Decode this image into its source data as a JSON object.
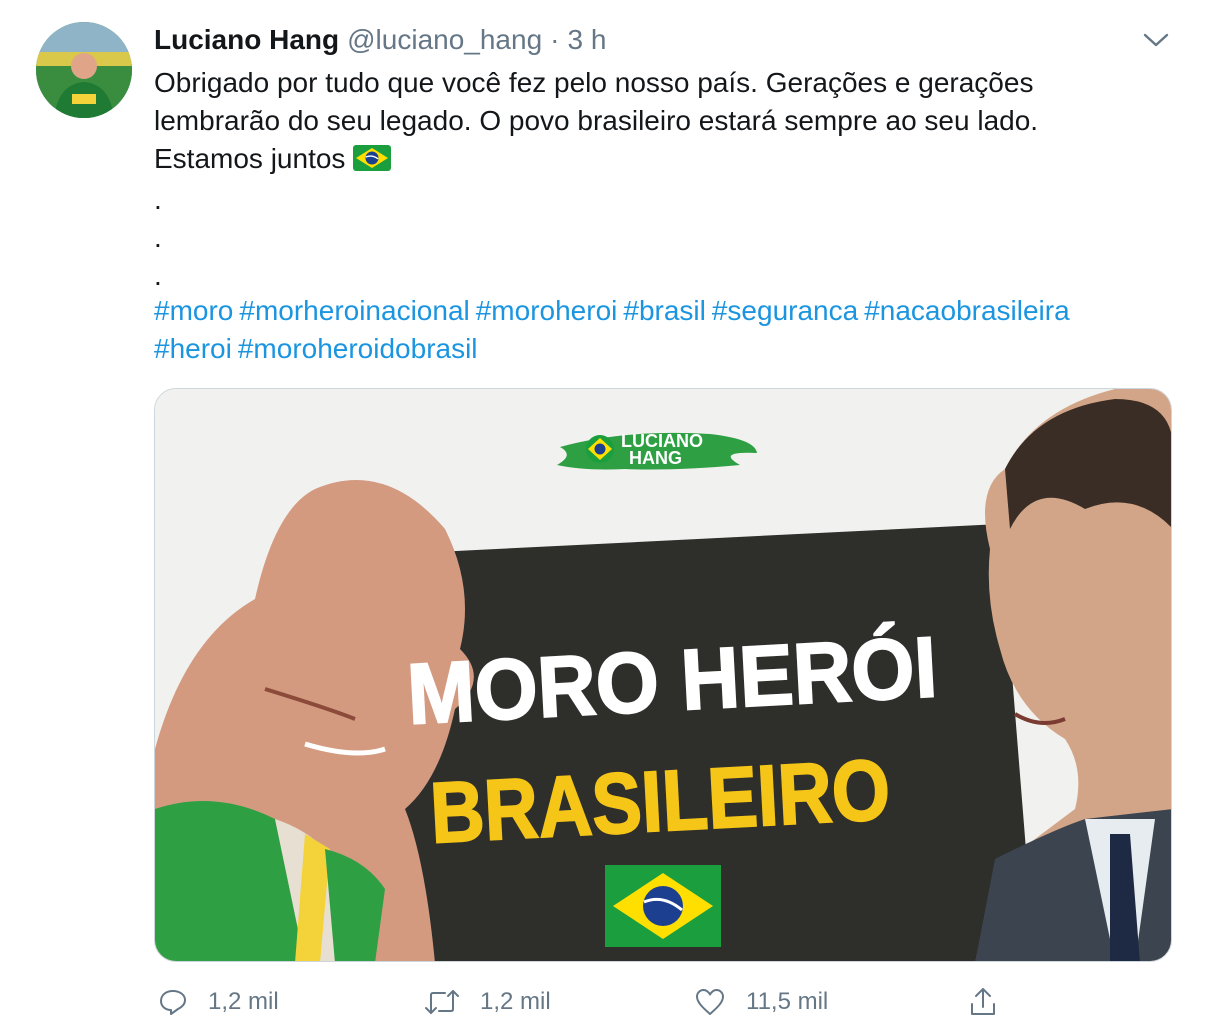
{
  "tweet": {
    "display_name": "Luciano Hang",
    "handle": "@luciano_hang",
    "separator": "·",
    "time": "3 h",
    "lines": [
      "Obrigado por tudo que você fez pelo nosso país. Gerações e gerações",
      "lembrarão do seu legado. O povo brasileiro estará sempre ao seu lado.",
      "Estamos juntos",
      ".",
      ".",
      "."
    ],
    "hashtags_line1": [
      "#moro",
      "#morheroinacional",
      "#moroheroi",
      "#brasil",
      "#seguranca",
      "#nacaobrasileira"
    ],
    "hashtags_line2": [
      "#heroi",
      "#moroheroidobrasil"
    ]
  },
  "media": {
    "logo_line1": "LUCIANO",
    "logo_line2": "HANG",
    "headline": "MORO HERÓI",
    "subheadline": "BRASILEIRO"
  },
  "actions": {
    "reply_count": "1,2 mil",
    "retweet_count": "1,2 mil",
    "like_count": "11,5 mil"
  },
  "colors": {
    "link": "#1b95e0",
    "muted": "#657786",
    "banner": "#2e2e2b",
    "headline_yellow": "#f5c518",
    "flag_green": "#1b9e3e",
    "flag_yellow": "#fedf00",
    "flag_blue": "#1d3f8f"
  },
  "icons": {
    "caret": "chevron-down-icon",
    "reply": "reply-icon",
    "retweet": "retweet-icon",
    "like": "heart-icon",
    "share": "share-icon",
    "flag": "brazil-flag-icon"
  }
}
